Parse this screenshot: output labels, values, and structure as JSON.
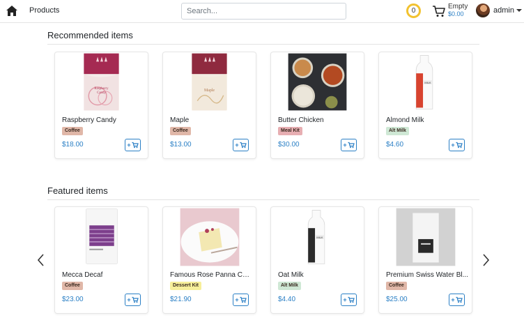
{
  "header": {
    "products_label": "Products",
    "search_placeholder": "Search...",
    "coins": "0",
    "cart_status": "Empty",
    "cart_total": "$0.00",
    "user_name": "admin"
  },
  "colors": {
    "accent": "#2a7fc5",
    "coin_ring": "#f2c22f",
    "tag_coffee": "#e0b7a8",
    "tag_mealkit": "#e7aeb2",
    "tag_altmilk": "#cfe8d5",
    "tag_dessert": "#f7ef9a"
  },
  "sections": [
    {
      "title": "Recommended items",
      "items": [
        {
          "name": "Raspberry Candy",
          "tag": "Coffee",
          "price": "$18.00",
          "image": "raspberry-candy-coffee-bag"
        },
        {
          "name": "Maple",
          "tag": "Coffee",
          "price": "$13.00",
          "image": "maple-coffee-bag"
        },
        {
          "name": "Butter Chicken",
          "tag": "Meal Kit",
          "price": "$30.00",
          "image": "butter-chicken-dishes"
        },
        {
          "name": "Almond Milk",
          "tag": "Alt Milk",
          "price": "$4.60",
          "image": "almond-milk-bottle"
        }
      ]
    },
    {
      "title": "Featured items",
      "items": [
        {
          "name": "Mecca Decaf",
          "tag": "Coffee",
          "price": "$23.00",
          "image": "mecca-decaf-bag"
        },
        {
          "name": "Famous Rose Panna Cotta",
          "tag": "Dessert Kit",
          "price": "$21.90",
          "image": "panna-cotta-plate"
        },
        {
          "name": "Oat Milk",
          "tag": "Alt Milk",
          "price": "$4.40",
          "image": "oat-milk-bottle"
        },
        {
          "name": "Premium Swiss Water Bl...",
          "tag": "Coffee",
          "price": "$25.00",
          "image": "swiss-water-bag"
        }
      ]
    }
  ],
  "add_label": "+"
}
